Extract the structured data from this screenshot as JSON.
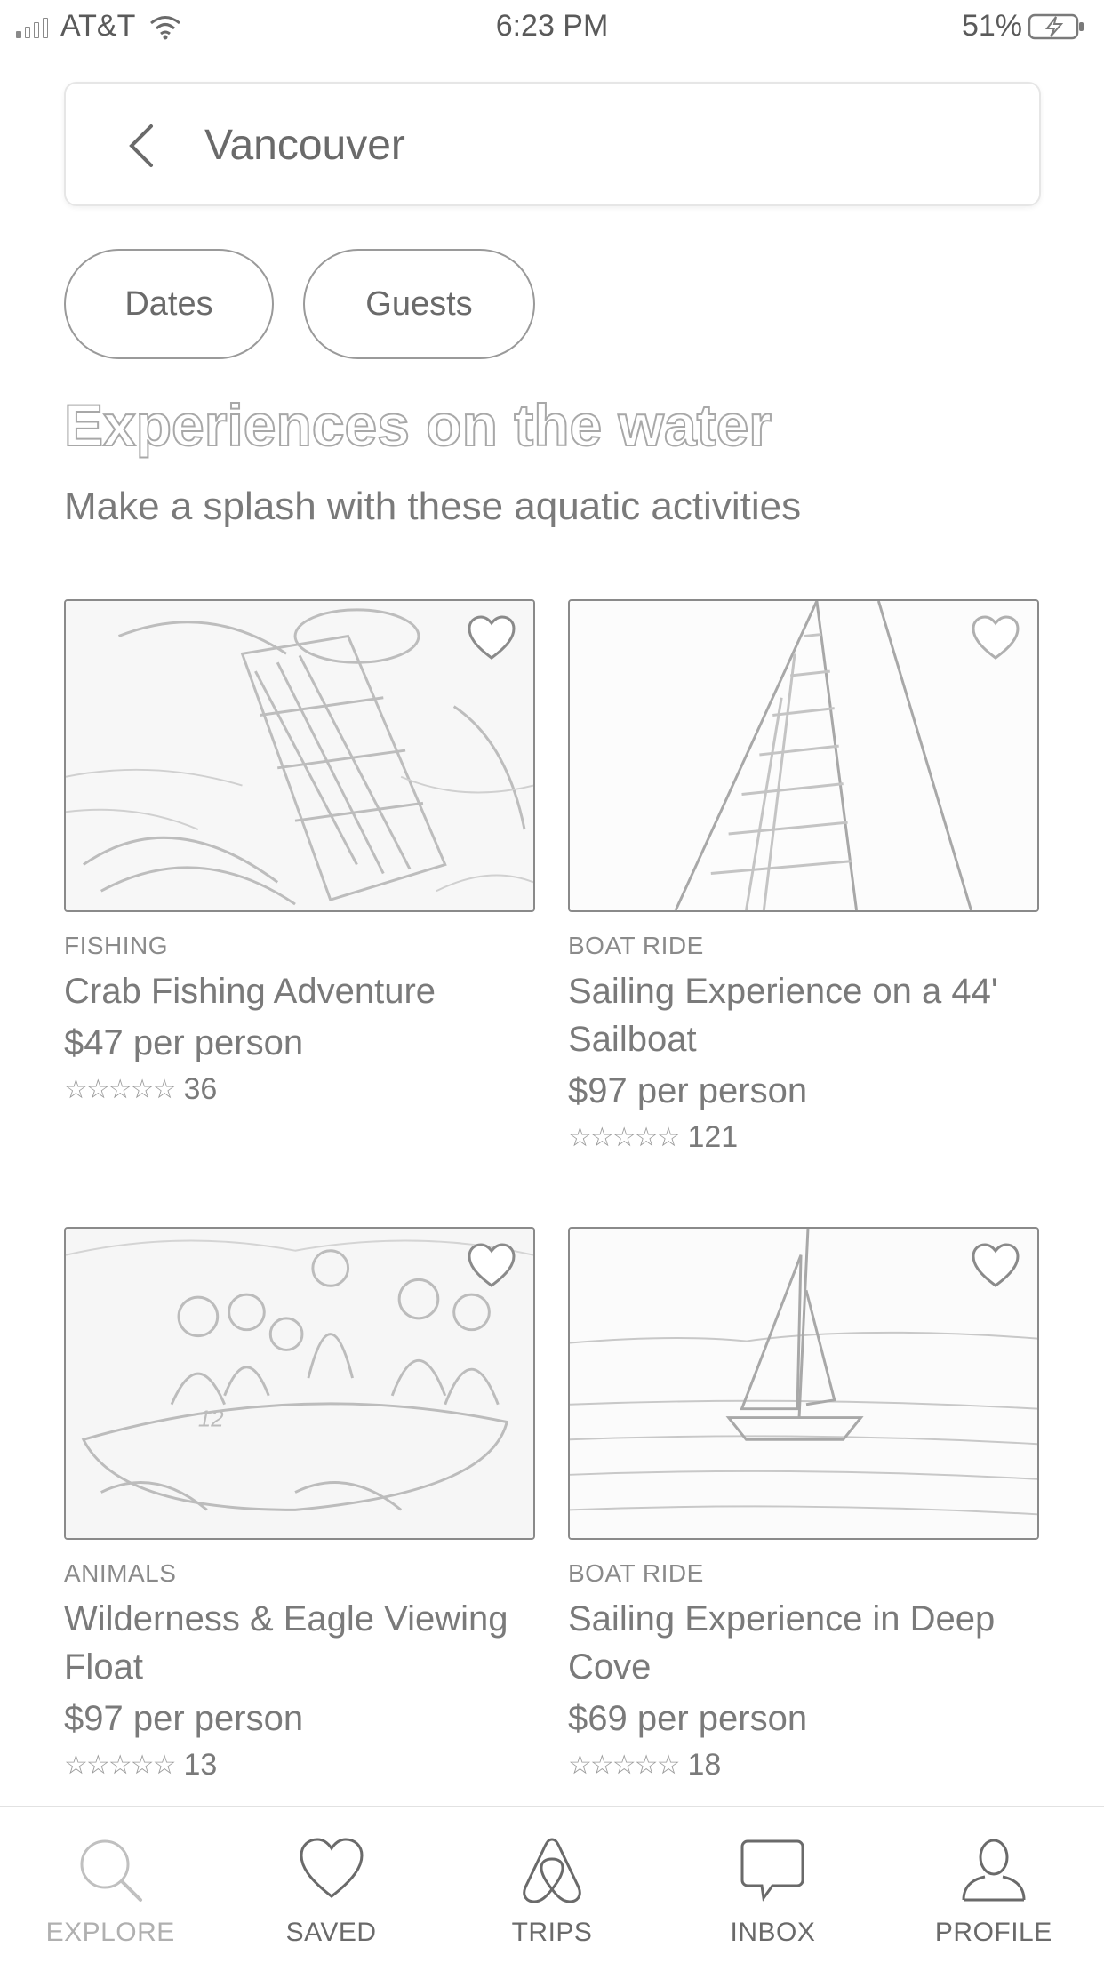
{
  "status_bar": {
    "carrier": "AT&T",
    "time": "6:23 PM",
    "battery": "51%",
    "icons": [
      "signal-icon",
      "wifi-icon",
      "battery-charging-icon"
    ]
  },
  "search": {
    "value": "Vancouver",
    "back_icon": "chevron-left-icon"
  },
  "filters": {
    "dates_label": "Dates",
    "guests_label": "Guests"
  },
  "section": {
    "title": "Experiences on the water",
    "subtitle": "Make a splash with these aquatic activities"
  },
  "cards": [
    {
      "category": "FISHING",
      "title": "Crab Fishing Adventure",
      "price": "$47 per person",
      "stars": "☆☆☆☆☆",
      "reviews": "36",
      "image": "crab-trap-photo"
    },
    {
      "category": "BOAT RIDE",
      "title": "Sailing Experience on a 44' Sailboat",
      "price": "$97 per person",
      "stars": "☆☆☆☆☆",
      "reviews": "121",
      "image": "sail-closeup-photo"
    },
    {
      "category": "ANIMALS",
      "title": "Wilderness & Eagle Viewing Float",
      "price": "$97 per person",
      "stars": "☆☆☆☆☆",
      "reviews": "13",
      "image": "rafting-group-photo"
    },
    {
      "category": "BOAT RIDE",
      "title": "Sailing Experience in Deep Cove",
      "price": "$69 per person",
      "stars": "☆☆☆☆☆",
      "reviews": "18",
      "image": "sailboat-on-water-photo"
    }
  ],
  "tab_bar": {
    "tabs": [
      {
        "label": "EXPLORE",
        "icon": "search-icon",
        "active": true
      },
      {
        "label": "SAVED",
        "icon": "heart-icon",
        "active": false
      },
      {
        "label": "TRIPS",
        "icon": "airbnb-logo-icon",
        "active": false
      },
      {
        "label": "INBOX",
        "icon": "chat-bubble-icon",
        "active": false
      },
      {
        "label": "PROFILE",
        "icon": "person-icon",
        "active": false
      }
    ]
  }
}
